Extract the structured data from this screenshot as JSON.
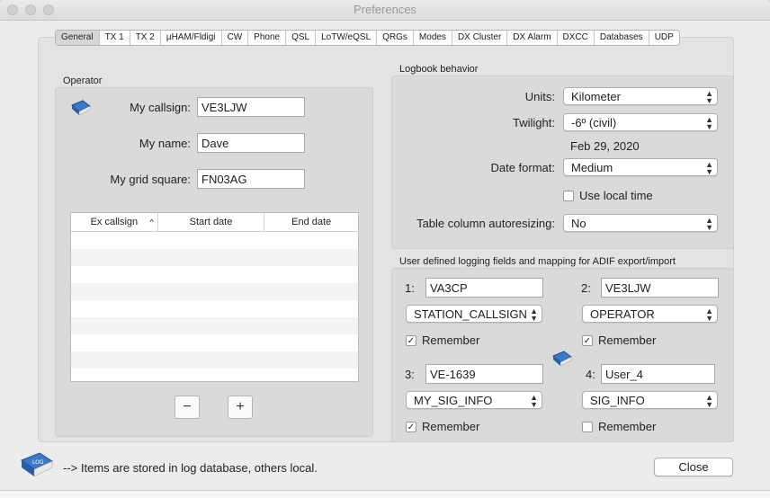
{
  "window": {
    "title": "Preferences"
  },
  "tabs": [
    {
      "label": "General",
      "active": true
    },
    {
      "label": "TX 1"
    },
    {
      "label": "TX 2"
    },
    {
      "label": "µHAM/Fldigi"
    },
    {
      "label": "CW"
    },
    {
      "label": "Phone"
    },
    {
      "label": "QSL"
    },
    {
      "label": "LoTW/eQSL"
    },
    {
      "label": "QRGs"
    },
    {
      "label": "Modes"
    },
    {
      "label": "DX Cluster"
    },
    {
      "label": "DX Alarm"
    },
    {
      "label": "DXCC"
    },
    {
      "label": "Databases"
    },
    {
      "label": "UDP"
    }
  ],
  "operator": {
    "group_label": "Operator",
    "callsign_label": "My callsign:",
    "callsign_value": "VE3LJW",
    "name_label": "My name:",
    "name_value": "Dave",
    "grid_label": "My grid square:",
    "grid_value": "FN03AG",
    "table_headers": [
      "Ex callsign",
      "Start date",
      "End date"
    ],
    "remove_label": "−",
    "add_label": "+"
  },
  "logbook": {
    "group_label": "Logbook behavior",
    "units_label": "Units:",
    "units_value": "Kilometer",
    "twilight_label": "Twilight:",
    "twilight_value": "-6º (civil)",
    "date_preview": "Feb 29, 2020",
    "date_format_label": "Date format:",
    "date_format_value": "Medium",
    "local_time_label": "Use local time",
    "local_time_checked": false,
    "autoresize_label": "Table column autoresizing:",
    "autoresize_value": "No"
  },
  "adif": {
    "group_label": "User defined logging fields and mapping for ADIF export/import",
    "fields": [
      {
        "num": "1:",
        "value": "VA3CP",
        "mapping": "STATION_CALLSIGN",
        "remember": "Remember",
        "checked": true
      },
      {
        "num": "2:",
        "value": "VE3LJW",
        "mapping": "OPERATOR",
        "remember": "Remember",
        "checked": true
      },
      {
        "num": "3:",
        "value": "VE-1639",
        "mapping": "MY_SIG_INFO",
        "remember": "Remember",
        "checked": true
      },
      {
        "num": "4:",
        "value": "User_4",
        "mapping": "SIG_INFO",
        "remember": "Remember",
        "checked": false
      }
    ]
  },
  "footer": {
    "note": "--> Items are stored in log database, others local.",
    "close_label": "Close"
  },
  "icons": {
    "book": "log-book-icon",
    "book_label": "LOG"
  },
  "colors": {
    "window_bg": "#ececec",
    "group_bg": "#dadada",
    "text": "#222222"
  }
}
